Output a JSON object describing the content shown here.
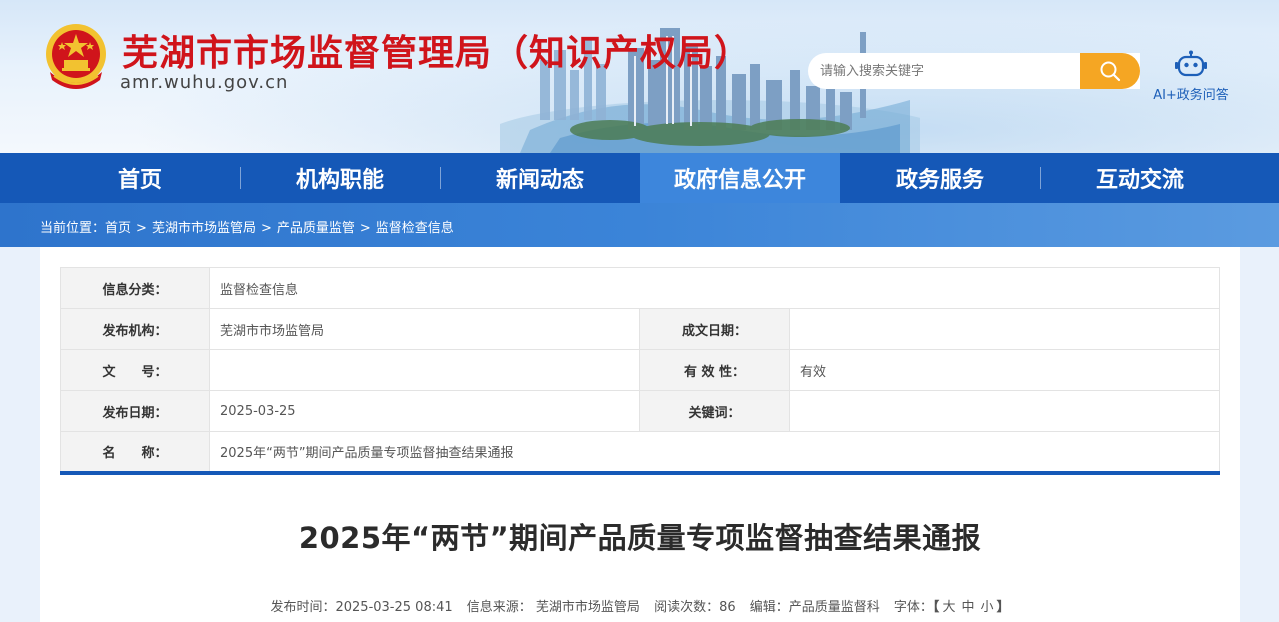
{
  "header": {
    "title": "芜湖市市场监督管理局（知识产权局）",
    "domain": "amr.wuhu.gov.cn",
    "search_placeholder": "请输入搜索关键字",
    "ai_label": "AI+政务问答"
  },
  "nav": {
    "items": [
      "首页",
      "机构职能",
      "新闻动态",
      "政府信息公开",
      "政务服务",
      "互动交流"
    ],
    "active": "政府信息公开"
  },
  "breadcrumb": {
    "prefix": "当前位置：",
    "items": [
      "首页",
      "芜湖市市场监管局",
      "产品质量监管",
      "监督检查信息"
    ],
    "separator": ">"
  },
  "info": {
    "category_label": "信息分类：",
    "category_value": "监督检查信息",
    "publisher_label": "发布机构：",
    "publisher_value": "芜湖市市场监管局",
    "created_label": "成文日期：",
    "created_value": "",
    "docno_label": "文　　号：",
    "docno_value": "",
    "validity_label": "有 效 性：",
    "validity_value": "有效",
    "pubdate_label": "发布日期：",
    "pubdate_value": "2025-03-25",
    "keywords_label": "关键词：",
    "keywords_value": "",
    "name_label": "名　　称：",
    "name_value": "2025年“两节”期间产品质量专项监督抽查结果通报"
  },
  "article": {
    "title": "2025年“两节”期间产品质量专项监督抽查结果通报",
    "publish_time": "发布时间：2025-03-25 08:41",
    "source": "信息来源： 芜湖市市场监管局",
    "views": "阅读次数：86",
    "editor": "编辑：产品质量监督科",
    "font_label": "字体：",
    "font_open": "【",
    "font_big": "大",
    "font_mid": "中",
    "font_small": "小",
    "font_close": "】"
  },
  "colors": {
    "title_red": "#d0141b",
    "nav_blue": "#1558b7",
    "nav_active": "#3d86dc",
    "search_orange": "#f5a623"
  }
}
